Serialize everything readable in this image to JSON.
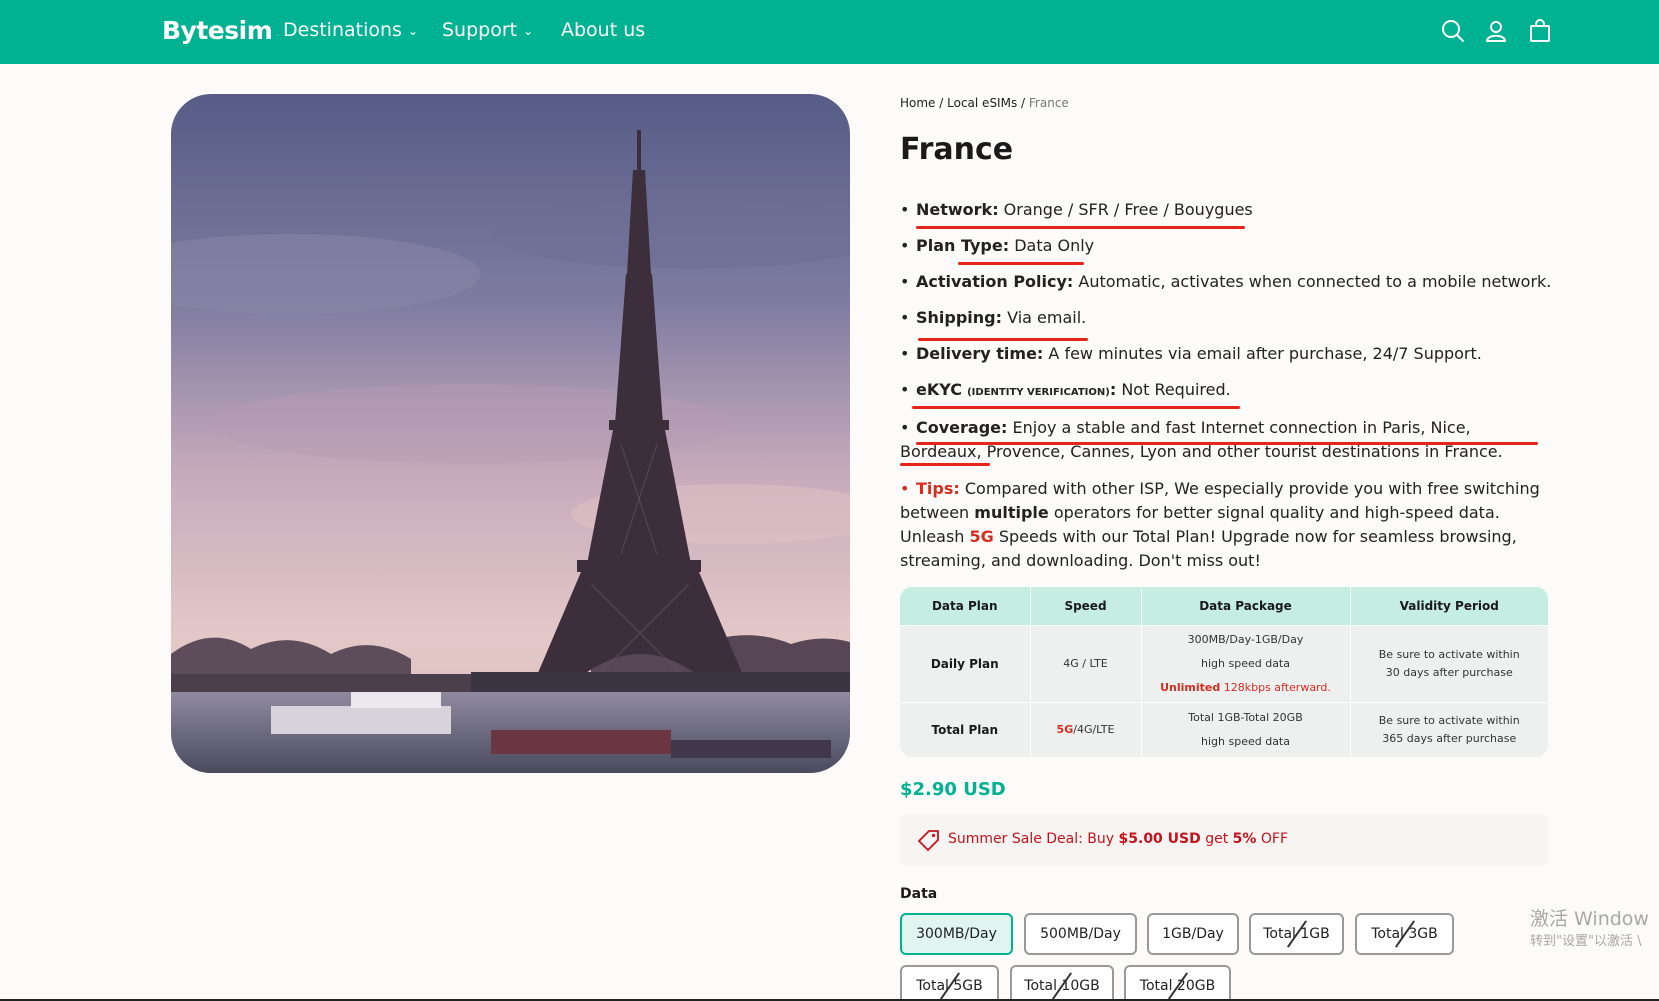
{
  "header": {
    "logo": "Bytesim",
    "nav": [
      {
        "label": "Destinations",
        "dropdown": true
      },
      {
        "label": "Support",
        "dropdown": true
      },
      {
        "label": "About us",
        "dropdown": false
      }
    ],
    "icons": [
      "search-icon",
      "account-icon",
      "cart-icon"
    ],
    "bg_color": "#00b291"
  },
  "breadcrumb": {
    "home": "Home",
    "sep": "/",
    "section": "Local eSIMs",
    "current": "France"
  },
  "title": "France",
  "features": {
    "network_label": "Network:",
    "network_value": " Orange / SFR / Free / Bouygues",
    "plan_label": "Plan Type:",
    "plan_value": " Data Only",
    "activation_label": "Activation Policy:",
    "activation_value": " Automatic, activates when connected to a mobile network.",
    "shipping_label": "Shipping:",
    "shipping_value": " Via email.",
    "delivery_label": "Delivery time:",
    "delivery_value": " A few minutes via email after purchase, 24/7 Support.",
    "ekyc_label": "eKYC",
    "ekyc_sub": "(IDENTITY VERIFICATION)",
    "ekyc_colon": ":",
    "ekyc_value": " Not Required.",
    "coverage_label": "Coverage:",
    "coverage_value": " Enjoy a stable and fast Internet connection in Paris, Nice, Bordeaux, Provence, Cannes, Lyon and other tourist destinations in France.",
    "tips_label": "Tips:",
    "tips_value_1": " Compared with other ISP, We especially provide you with free switching between ",
    "tips_multiple": "multiple",
    "tips_value_2": " operators for better signal quality and high-speed data. Unleash ",
    "tips_5g": "5G",
    "tips_value_3": " Speeds with our Total Plan! Upgrade now for seamless browsing, streaming, and downloading. Don't miss out!"
  },
  "table": {
    "headers": [
      "Data Plan",
      "Speed",
      "Data Package",
      "Validity Period"
    ],
    "daily": {
      "name": "Daily Plan",
      "speed": "4G / LTE",
      "package_1": "300MB/Day-1GB/Day",
      "package_2": "high speed data",
      "unlimited": "Unlimited",
      "unlimited_rest": " 128kbps afterward.",
      "validity": "Be sure to activate within 30 days after purchase"
    },
    "total": {
      "name": "Total Plan",
      "speed_5g": "5G",
      "speed_rest": "/4G/LTE",
      "package_1": "Total 1GB-Total 20GB",
      "package_2": "high speed data",
      "validity": "Be sure to activate within 365 days after purchase"
    }
  },
  "price": "$2.90 USD",
  "sale": {
    "prefix": "Summer Sale Deal: Buy ",
    "amount": "$5.00 USD",
    "mid": " get ",
    "pct": "5%",
    "suffix": " OFF"
  },
  "data_label": "Data",
  "options": [
    {
      "label": "300MB/Day",
      "selected": true,
      "sold_out": false
    },
    {
      "label": "500MB/Day",
      "selected": false,
      "sold_out": false
    },
    {
      "label": "1GB/Day",
      "selected": false,
      "sold_out": false
    },
    {
      "label": "Total 1GB",
      "selected": false,
      "sold_out": true
    },
    {
      "label": "Total 3GB",
      "selected": false,
      "sold_out": true
    },
    {
      "label": "Total 5GB",
      "selected": false,
      "sold_out": true
    },
    {
      "label": "Total 10GB",
      "selected": false,
      "sold_out": true
    },
    {
      "label": "Total 20GB",
      "selected": false,
      "sold_out": true
    }
  ],
  "watermark": {
    "line1": "激活 Window",
    "line2": "转到\"设置\"以激活 \\"
  },
  "colors": {
    "accent": "#00b291",
    "highlight_red": "#e8231a",
    "sale_red": "#c5121d"
  }
}
